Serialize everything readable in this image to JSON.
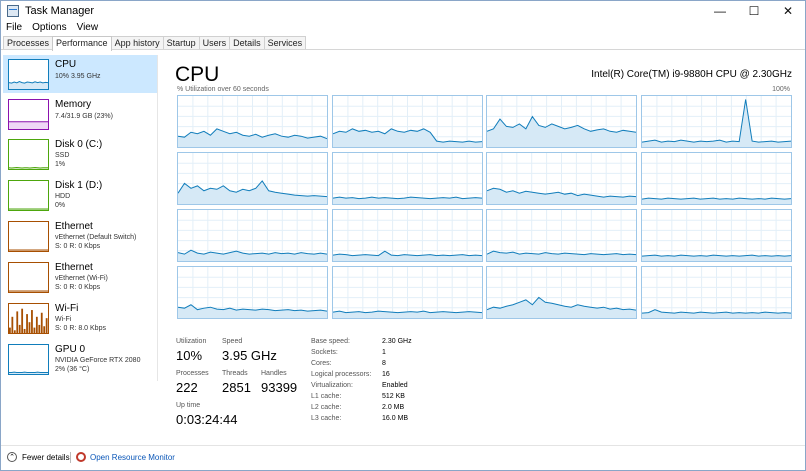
{
  "window": {
    "title": "Task Manager",
    "controls": [
      "—",
      "☐",
      "✕"
    ]
  },
  "menu": [
    "File",
    "Options",
    "View"
  ],
  "tabs": [
    {
      "label": "Processes",
      "active": false
    },
    {
      "label": "Performance",
      "active": true
    },
    {
      "label": "App history",
      "active": false
    },
    {
      "label": "Startup",
      "active": false
    },
    {
      "label": "Users",
      "active": false
    },
    {
      "label": "Details",
      "active": false
    },
    {
      "label": "Services",
      "active": false
    }
  ],
  "sidebar": [
    {
      "name": "CPU",
      "lines": [
        "10% 3.95 GHz"
      ],
      "color": "#117dbb",
      "selected": true
    },
    {
      "name": "Memory",
      "lines": [
        "7.4/31.9 GB (23%)"
      ],
      "color": "#8b12ae",
      "selected": false
    },
    {
      "name": "Disk 0 (C:)",
      "lines": [
        "SSD",
        "1%"
      ],
      "color": "#4da60c",
      "selected": false
    },
    {
      "name": "Disk 1 (D:)",
      "lines": [
        "HDD",
        "0%"
      ],
      "color": "#4da60c",
      "selected": false
    },
    {
      "name": "Ethernet",
      "lines": [
        "vEthernet (Default Switch)",
        "S: 0 R: 0 Kbps"
      ],
      "color": "#a74f01",
      "selected": false
    },
    {
      "name": "Ethernet",
      "lines": [
        "vEthernet (Wi-Fi)",
        "S: 0 R: 0 Kbps"
      ],
      "color": "#a74f01",
      "selected": false
    },
    {
      "name": "Wi-Fi",
      "lines": [
        "Wi-Fi",
        "S: 0 R: 8.0 Kbps"
      ],
      "color": "#a74f01",
      "selected": false
    },
    {
      "name": "GPU 0",
      "lines": [
        "NVIDIA GeForce RTX 2080",
        "2% (36 °C)"
      ],
      "color": "#117dbb",
      "selected": false
    }
  ],
  "main": {
    "title": "CPU",
    "model": "Intel(R) Core(TM) i9-9880H CPU @ 2.30GHz",
    "graph_label": "% Utilization over 60 seconds",
    "graph_max": "100%",
    "graph_color": "#117dbb",
    "graph_fill": "#d6e9f6"
  },
  "stats": {
    "utilization_label": "Utilization",
    "utilization": "10%",
    "speed_label": "Speed",
    "speed": "3.95 GHz",
    "processes_label": "Processes",
    "processes": "222",
    "threads_label": "Threads",
    "threads": "2851",
    "handles_label": "Handles",
    "handles": "93399",
    "uptime_label": "Up time",
    "uptime": "0:03:24:44"
  },
  "specs": [
    {
      "k": "Base speed:",
      "v": "2.30 GHz"
    },
    {
      "k": "Sockets:",
      "v": "1"
    },
    {
      "k": "Cores:",
      "v": "8"
    },
    {
      "k": "Logical processors:",
      "v": "16"
    },
    {
      "k": "Virtualization:",
      "v": "Enabled"
    },
    {
      "k": "L1 cache:",
      "v": "512 KB"
    },
    {
      "k": "L2 cache:",
      "v": "2.0 MB"
    },
    {
      "k": "L3 cache:",
      "v": "16.0 MB"
    }
  ],
  "footer": {
    "fewer_details": "Fewer details",
    "open_monitor": "Open Resource Monitor"
  },
  "core_graphs": [
    [
      20,
      18,
      28,
      25,
      30,
      22,
      35,
      30,
      25,
      28,
      22,
      20,
      24,
      18,
      22,
      25,
      20,
      18,
      22,
      20,
      16,
      18,
      20,
      15
    ],
    [
      25,
      30,
      28,
      35,
      30,
      32,
      28,
      30,
      25,
      35,
      30,
      28,
      32,
      30,
      35,
      28,
      10,
      8,
      10,
      9,
      8,
      10,
      8,
      9
    ],
    [
      30,
      35,
      55,
      40,
      38,
      45,
      35,
      60,
      42,
      38,
      45,
      40,
      35,
      38,
      42,
      35,
      30,
      33,
      35,
      30,
      28,
      32,
      30,
      28
    ],
    [
      8,
      10,
      12,
      8,
      10,
      9,
      12,
      10,
      8,
      10,
      9,
      10,
      12,
      8,
      10,
      9,
      95,
      10,
      8,
      9,
      10,
      8,
      9,
      10
    ],
    [
      20,
      40,
      30,
      35,
      25,
      30,
      28,
      35,
      25,
      22,
      28,
      25,
      30,
      45,
      25,
      22,
      20,
      18,
      16,
      15,
      14,
      15,
      14,
      13
    ],
    [
      10,
      12,
      10,
      11,
      9,
      10,
      12,
      10,
      11,
      10,
      9,
      10,
      12,
      11,
      10,
      9,
      10,
      11,
      10,
      12,
      9,
      10,
      11,
      10
    ],
    [
      25,
      30,
      28,
      22,
      25,
      20,
      24,
      22,
      20,
      18,
      20,
      22,
      18,
      20,
      15,
      18,
      16,
      14,
      12,
      14,
      13,
      12,
      14,
      13
    ],
    [
      8,
      10,
      9,
      8,
      10,
      9,
      8,
      9,
      10,
      8,
      9,
      10,
      8,
      9,
      8,
      10,
      9,
      8,
      9,
      8,
      10,
      9,
      8,
      9
    ],
    [
      15,
      12,
      20,
      14,
      12,
      16,
      14,
      12,
      15,
      18,
      14,
      12,
      13,
      14,
      12,
      15,
      13,
      14,
      12,
      15,
      13,
      12,
      14,
      12
    ],
    [
      10,
      12,
      11,
      9,
      10,
      11,
      10,
      9,
      18,
      10,
      9,
      11,
      10,
      9,
      10,
      11,
      9,
      10,
      9,
      10,
      11,
      9,
      10,
      9
    ],
    [
      12,
      18,
      15,
      14,
      16,
      12,
      14,
      13,
      12,
      15,
      13,
      12,
      14,
      13,
      12,
      11,
      13,
      12,
      11,
      12,
      13,
      11,
      12,
      11
    ],
    [
      8,
      9,
      10,
      8,
      9,
      8,
      10,
      9,
      8,
      9,
      8,
      10,
      9,
      8,
      9,
      8,
      9,
      10,
      8,
      9,
      8,
      9,
      8,
      9
    ],
    [
      20,
      18,
      25,
      15,
      18,
      20,
      16,
      15,
      18,
      14,
      16,
      15,
      14,
      16,
      15,
      13,
      14,
      15,
      13,
      14,
      12,
      13,
      14,
      12
    ],
    [
      10,
      12,
      9,
      10,
      11,
      9,
      10,
      12,
      11,
      10,
      9,
      10,
      11,
      10,
      12,
      9,
      10,
      11,
      10,
      9,
      10,
      11,
      10,
      9
    ],
    [
      15,
      20,
      18,
      22,
      25,
      30,
      35,
      25,
      40,
      30,
      28,
      25,
      22,
      20,
      25,
      22,
      20,
      18,
      20,
      16,
      18,
      15,
      16,
      14
    ],
    [
      8,
      9,
      15,
      10,
      9,
      8,
      10,
      9,
      8,
      10,
      9,
      8,
      9,
      10,
      8,
      9,
      8,
      9,
      8,
      10,
      9,
      8,
      9,
      8
    ]
  ],
  "thumb_graphs": {
    "cpu": [
      20,
      18,
      22,
      19,
      24,
      20,
      18,
      22,
      21,
      19,
      23,
      20,
      22,
      19,
      21,
      20
    ],
    "memory": [
      23,
      23,
      23,
      23,
      23,
      23,
      23,
      23,
      23,
      23,
      23,
      23,
      23,
      23,
      23,
      23
    ],
    "disk0": [
      1,
      0,
      1,
      2,
      1,
      0,
      1,
      1,
      0,
      1,
      2,
      1,
      0,
      1,
      1,
      1
    ],
    "disk1": [
      0,
      0,
      0,
      0,
      0,
      0,
      0,
      0,
      0,
      0,
      0,
      0,
      0,
      0,
      0,
      0
    ],
    "eth1": [
      0,
      0,
      0,
      0,
      0,
      0,
      0,
      0,
      0,
      0,
      0,
      0,
      0,
      0,
      0,
      0
    ],
    "eth2": [
      0,
      0,
      0,
      0,
      0,
      0,
      0,
      0,
      0,
      0,
      0,
      0,
      0,
      0,
      0,
      0
    ],
    "wifi": [
      20,
      60,
      10,
      80,
      30,
      90,
      15,
      70,
      40,
      85,
      20,
      60,
      30,
      75,
      25,
      55
    ],
    "gpu": [
      2,
      2,
      3,
      2,
      2,
      2,
      3,
      2,
      2,
      2,
      2,
      3,
      2,
      2,
      2,
      2
    ]
  }
}
